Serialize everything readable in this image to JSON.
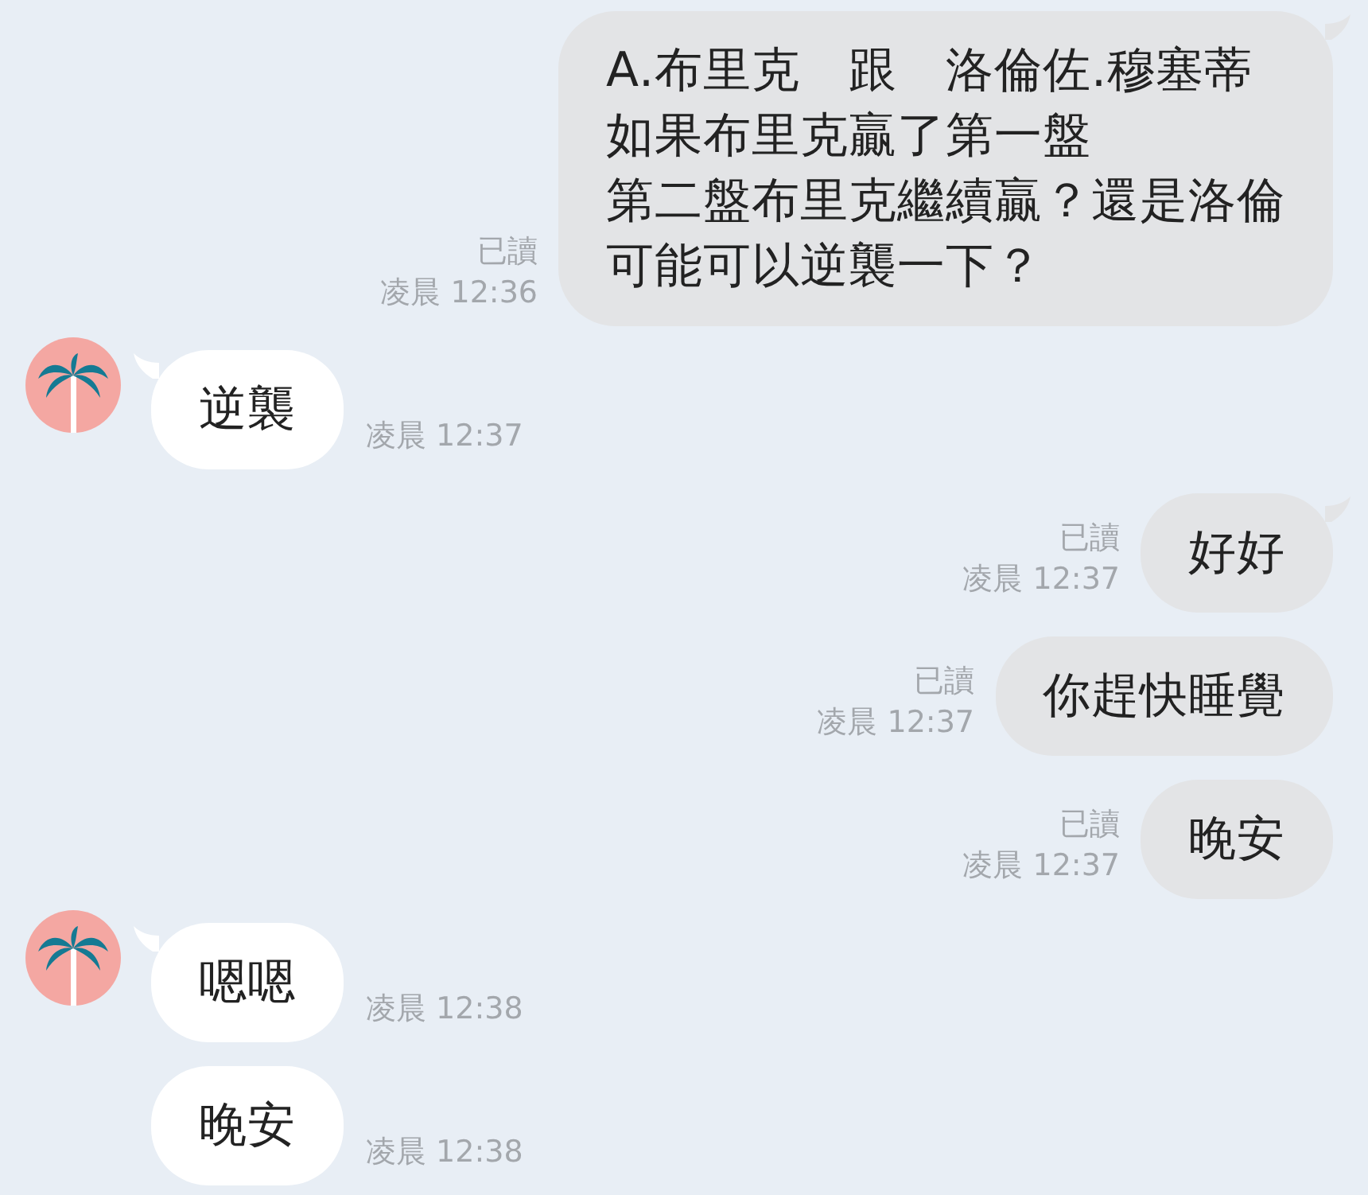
{
  "messages": [
    {
      "kind": "sent",
      "tail": true,
      "lines": [
        "A.布里克　跟　洛倫佐.穆塞蒂",
        "如果布里克贏了第一盤",
        "第二盤布里克繼續贏？還是洛倫",
        "可能可以逆襲一下？"
      ],
      "read": "已讀",
      "time": "凌晨 12:36"
    },
    {
      "kind": "received",
      "tail": true,
      "lines": [
        "逆襲"
      ],
      "time": "凌晨 12:37"
    },
    {
      "kind": "sent",
      "tail": true,
      "lines": [
        "好好"
      ],
      "read": "已讀",
      "time": "凌晨 12:37"
    },
    {
      "kind": "sent",
      "tail": false,
      "lines": [
        "你趕快睡覺"
      ],
      "read": "已讀",
      "time": "凌晨 12:37"
    },
    {
      "kind": "sent",
      "tail": false,
      "lines": [
        "晚安"
      ],
      "read": "已讀",
      "time": "凌晨 12:37"
    },
    {
      "kind": "received",
      "tail": true,
      "lines": [
        "嗯嗯"
      ],
      "time": "凌晨 12:38"
    },
    {
      "kind": "received",
      "tail": false,
      "lines": [
        "晚安"
      ],
      "time": "凌晨 12:38"
    }
  ]
}
